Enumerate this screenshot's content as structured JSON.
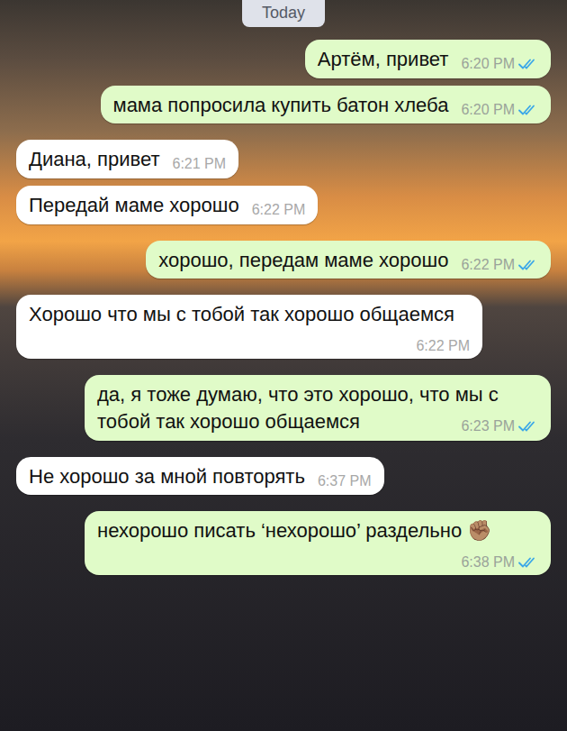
{
  "chat": {
    "date_label": "Today"
  },
  "messages": [
    {
      "text": "Артём, привет",
      "time": "6:20 PM",
      "direction": "out",
      "read": true
    },
    {
      "text": "мама попросила купить батон хлеба",
      "time": "6:20 PM",
      "direction": "out",
      "read": true
    },
    {
      "text": "Диана, привет",
      "time": "6:21 PM",
      "direction": "in",
      "read": false
    },
    {
      "text": "Передай маме хорошо",
      "time": "6:22 PM",
      "direction": "in",
      "read": false
    },
    {
      "text": "хорошо, передам маме хорошо",
      "time": "6:22 PM",
      "direction": "out",
      "read": true
    },
    {
      "text": "Хорошо что мы с тобой так хорошо общаемся",
      "time": "6:22 PM",
      "direction": "in",
      "read": false
    },
    {
      "text": "да, я тоже думаю, что это хорошо, что мы с тобой так хорошо общаемся",
      "time": "6:23 PM",
      "direction": "out",
      "read": true
    },
    {
      "text": "Не хорошо за мной повторять",
      "time": "6:37 PM",
      "direction": "in",
      "read": false
    },
    {
      "text": "нехорошо писать ‘нехорошо’ раздельно ✊🏽",
      "time": "6:38 PM",
      "direction": "out",
      "read": true
    }
  ]
}
